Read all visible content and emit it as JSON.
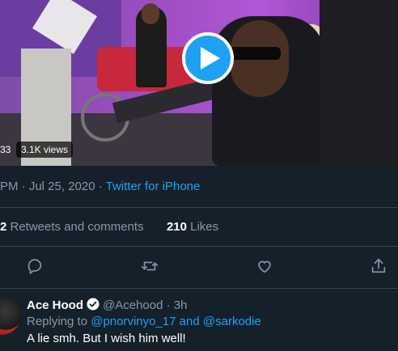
{
  "video": {
    "time_fragment": "33",
    "views": "3.1K views"
  },
  "tweet": {
    "timestamp": "PM · Jul 25, 2020 · ",
    "source": "Twitter for iPhone"
  },
  "stats": {
    "retweets_count": "2",
    "retweets_label": " Retweets and comments",
    "likes_count": "210",
    "likes_label": " Likes"
  },
  "actions": {
    "icons": [
      "comment-icon",
      "retweet-icon",
      "like-icon",
      "share-icon"
    ]
  },
  "reply": {
    "name": "Ace Hood",
    "handle": "@Acehood · 3h",
    "replying_prefix": "Replying to ",
    "replying_user1": "@pnorvinyo_17",
    "replying_and": " and ",
    "replying_user2": "@sarkodie",
    "text": "A lie smh. But I wish him well!"
  },
  "colors": {
    "background": "#15202b",
    "accent": "#1da1f2",
    "secondary_text": "#8899a6",
    "divider": "#38444d"
  }
}
